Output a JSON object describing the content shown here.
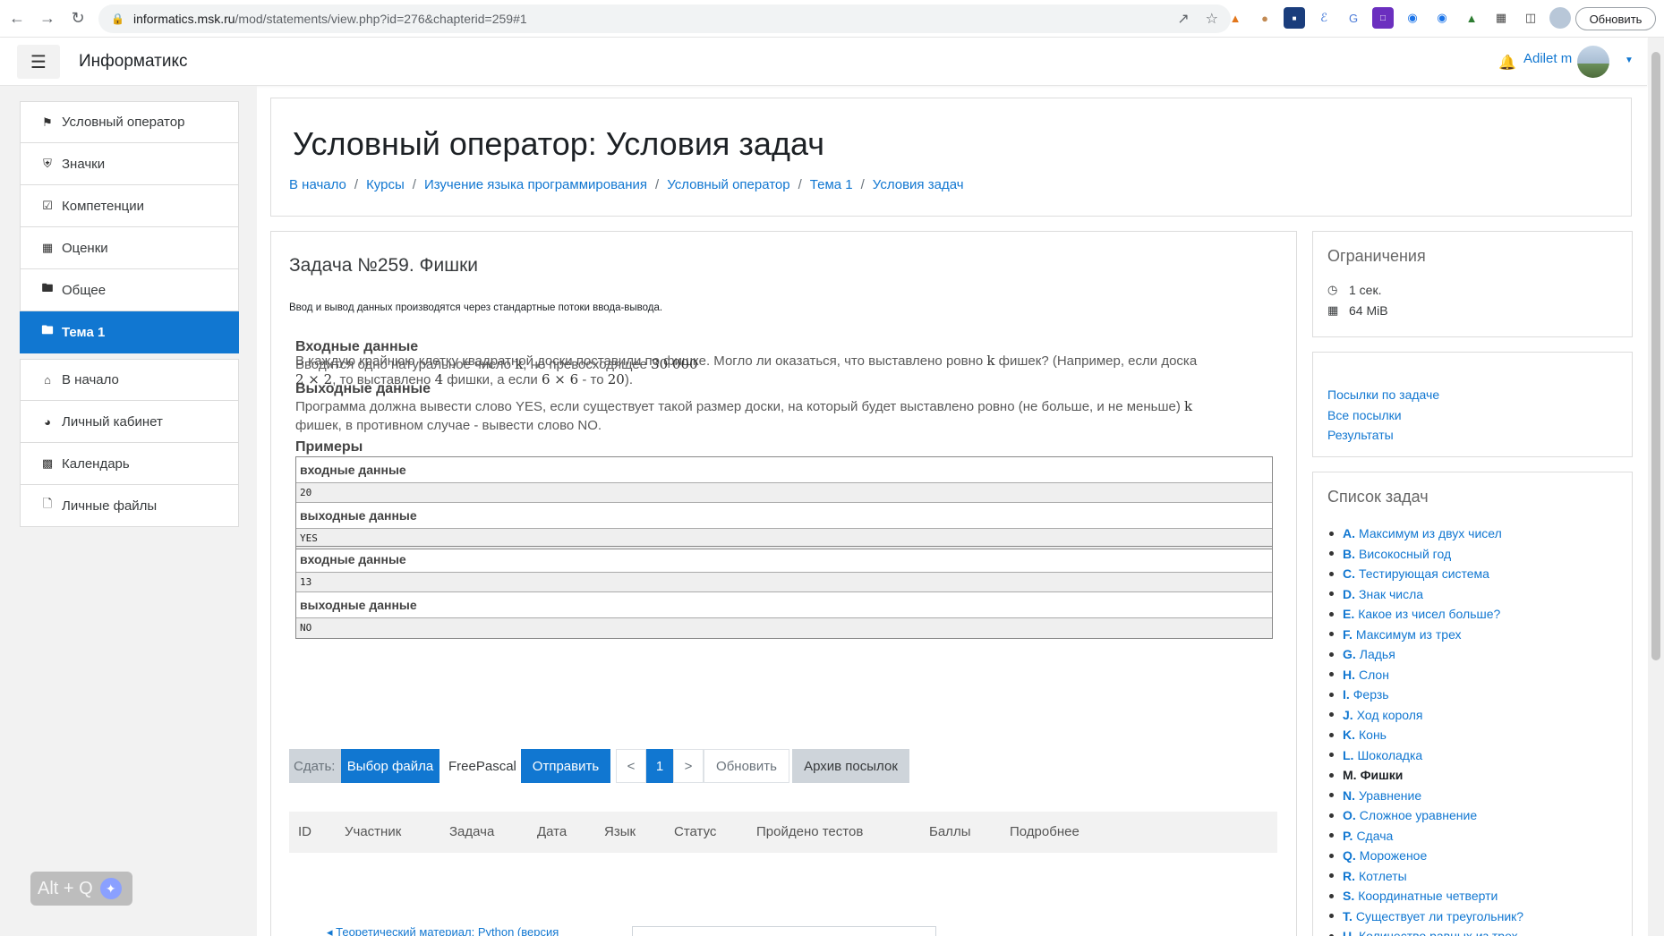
{
  "browser": {
    "url_host": "informatics.msk.ru",
    "url_path": "/mod/statements/view.php?id=276&chapterid=259#1",
    "update_label": "Обновить"
  },
  "header": {
    "brand": "Информатикс",
    "username": "Adilet m"
  },
  "sidebar": {
    "items": [
      {
        "label": "Условный оператор",
        "icon": "graduation-cap-icon"
      },
      {
        "label": "Значки",
        "icon": "shield-icon"
      },
      {
        "label": "Компетенции",
        "icon": "checkbox-icon"
      },
      {
        "label": "Оценки",
        "icon": "table-icon"
      },
      {
        "label": "Общее",
        "icon": "folder-icon"
      },
      {
        "label": "Тема 1",
        "icon": "folder-icon",
        "active": true
      }
    ],
    "items2": [
      {
        "label": "В начало",
        "icon": "home-icon"
      },
      {
        "label": "Личный кабинет",
        "icon": "dashboard-icon"
      },
      {
        "label": "Календарь",
        "icon": "calendar-icon"
      },
      {
        "label": "Личные файлы",
        "icon": "file-icon"
      }
    ]
  },
  "main": {
    "title": "Условный оператор: Условия задач",
    "breadcrumb": [
      "В начало",
      "Курсы",
      "Изучение языка программирования",
      "Условный оператор",
      "Тема 1",
      "Условия задач"
    ]
  },
  "task": {
    "title": "Задача №259. Фишки",
    "io_note": "Ввод и вывод данных производятся через стандартные потоки ввода-вывода.",
    "statement_1": "В каждую крайнюю клетку квадратной доски поставили по фишке. Могло ли оказаться, что выставлено ровно",
    "statement_k": "k",
    "statement_2": "фишек? (Например, если доска",
    "statement_3a": "2 × 2",
    "statement_3b": ", то выставлено",
    "statement_3c": "4",
    "statement_3d": "фишки, а если",
    "statement_3e": "6 × 6",
    "statement_3f": "- то",
    "statement_3g": "20",
    "statement_3h": ").",
    "input_h": "Входные данные",
    "input_t1": "Вводится одно натуральное число",
    "input_t2": "k",
    "input_t3": ", не превосходящее",
    "input_t4": "30 000",
    "output_h": "Выходные данные",
    "output_t1": "Программа должна вывести слово YES, если существует такой размер доски, на который будет выставлено ровно (не больше, и не меньше)",
    "output_t2": "k",
    "output_t3": "фишек, в противном случае - вывести слово NO.",
    "examples_h": "Примеры",
    "examples": [
      {
        "in_label": "входные данные",
        "in": "20",
        "out_label": "выходные данные",
        "out": "YES"
      },
      {
        "in_label": "входные данные",
        "in": "13",
        "out_label": "выходные данные",
        "out": "NO"
      }
    ]
  },
  "submit": {
    "label": "Сдать:",
    "file": "Выбор файла",
    "lang": "FreePascal",
    "send": "Отправить",
    "prev": "<",
    "page": "1",
    "next": ">",
    "refresh": "Обновить",
    "archive": "Архив посылок"
  },
  "runs_table": {
    "columns": [
      "ID",
      "Участник",
      "Задача",
      "Дата",
      "Язык",
      "Статус",
      "Пройдено тестов",
      "Баллы",
      "Подробнее"
    ]
  },
  "bottom": {
    "link": "◂ Теоретический материал: Python (версия"
  },
  "limits": {
    "title": "Ограничения",
    "time": "1 сек.",
    "memory": "64 MiB"
  },
  "links": [
    "Посылки по задаче",
    "Все посылки",
    "Результаты"
  ],
  "task_list": {
    "title": "Список задач",
    "items": [
      {
        "letter": "A.",
        "name": "Максимум из двух чисел"
      },
      {
        "letter": "B.",
        "name": "Високосный год"
      },
      {
        "letter": "C.",
        "name": "Тестирующая система"
      },
      {
        "letter": "D.",
        "name": "Знак числа"
      },
      {
        "letter": "E.",
        "name": "Какое из чисел больше?"
      },
      {
        "letter": "F.",
        "name": "Максимум из трех"
      },
      {
        "letter": "G.",
        "name": "Ладья"
      },
      {
        "letter": "H.",
        "name": "Слон"
      },
      {
        "letter": "I.",
        "name": "Ферзь"
      },
      {
        "letter": "J.",
        "name": "Ход короля"
      },
      {
        "letter": "K.",
        "name": "Конь"
      },
      {
        "letter": "L.",
        "name": "Шоколадка"
      },
      {
        "letter": "M.",
        "name": "Фишки",
        "current": true
      },
      {
        "letter": "N.",
        "name": "Уравнение"
      },
      {
        "letter": "O.",
        "name": "Сложное уравнение"
      },
      {
        "letter": "P.",
        "name": "Сдача"
      },
      {
        "letter": "Q.",
        "name": "Мороженое"
      },
      {
        "letter": "R.",
        "name": "Котлеты"
      },
      {
        "letter": "S.",
        "name": "Координатные четверти"
      },
      {
        "letter": "T.",
        "name": "Существует ли треугольник?"
      },
      {
        "letter": "U.",
        "name": "Количество равных из трех"
      }
    ]
  },
  "overlay": {
    "altq": "Alt + Q"
  },
  "colors": {
    "accent": "#1177d1",
    "drawer_bg": "#f2f2f2"
  }
}
